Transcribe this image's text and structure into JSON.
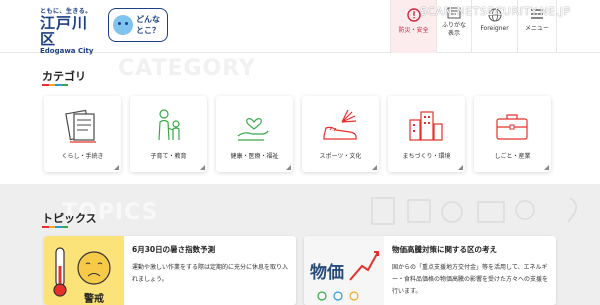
{
  "header": {
    "logo_tagline": "ともに、生きる。",
    "logo_kanji": "江戸川区",
    "logo_english": "Edogawa City",
    "bubble_text_line1": "どんな",
    "bubble_text_line2": "とこ？",
    "buttons": [
      {
        "label": "防災・安全",
        "icon": "alert-circle-icon"
      },
      {
        "label": "ふりがな\n表示",
        "icon": "furigana-icon"
      },
      {
        "label": "Foreigner",
        "icon": "globe-icon"
      },
      {
        "label": "メニュー",
        "icon": "menu-icon"
      }
    ]
  },
  "watermark": "SCAN.NETSECURITY.NE.JP",
  "categories": {
    "title": "カテゴリ",
    "bg_word": "CATEGORY",
    "bar_colors": [
      "#e6302b",
      "#f5a623",
      "#2b9ad8",
      "#3aa84a"
    ],
    "items": [
      {
        "label": "くらし・手続き",
        "icon": "documents-icon"
      },
      {
        "label": "子育て・教育",
        "icon": "parent-child-icon"
      },
      {
        "label": "健康・医療・福祉",
        "icon": "hand-heart-icon"
      },
      {
        "label": "スポーツ・文化",
        "icon": "sneaker-fan-icon"
      },
      {
        "label": "まちづくり・環境",
        "icon": "buildings-icon"
      },
      {
        "label": "しごと・産業",
        "icon": "briefcase-icon"
      }
    ]
  },
  "topics": {
    "title": "トピックス",
    "bg_word": "TOPICS",
    "items": [
      {
        "title": "6月30日の暑さ指数予測",
        "body": "運動や激しい作業をする際は定期的に充分に休息を取り入れましょう。",
        "thumb_text": "警戒",
        "thumb_icon": "thermometer-face-icon"
      },
      {
        "title": "物価高騰対策に関する区の考え",
        "body": "国からの「重点支援地方交付金」等を活用して、エネルギー・食料品価格の物価高騰の影響を受けた方々への支援を行います。",
        "thumb_text": "物価",
        "thumb_icon": "price-graph-icon"
      }
    ]
  }
}
